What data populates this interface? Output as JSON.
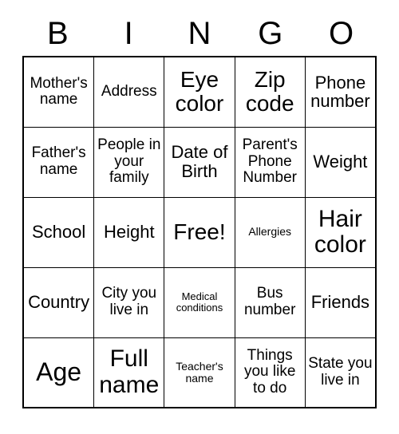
{
  "card": {
    "title_letters": [
      "B",
      "I",
      "N",
      "G",
      "O"
    ],
    "rows": [
      [
        {
          "text": "Mother's name",
          "size": "m"
        },
        {
          "text": "Address",
          "size": "m"
        },
        {
          "text": "Eye color",
          "size": "xl"
        },
        {
          "text": "Zip code",
          "size": "xl"
        },
        {
          "text": "Phone number",
          "size": "l"
        }
      ],
      [
        {
          "text": "Father's name",
          "size": "m"
        },
        {
          "text": "People in your family",
          "size": "m"
        },
        {
          "text": "Date of Birth",
          "size": "l"
        },
        {
          "text": "Parent's Phone Number",
          "size": "m"
        },
        {
          "text": "Weight",
          "size": "l"
        }
      ],
      [
        {
          "text": "School",
          "size": "l"
        },
        {
          "text": "Height",
          "size": "l"
        },
        {
          "text": "Free!",
          "size": "xl"
        },
        {
          "text": "Allergies",
          "size": "s"
        },
        {
          "text": "Hair color",
          "size": "xxl"
        }
      ],
      [
        {
          "text": "Country",
          "size": "l"
        },
        {
          "text": "City you live in",
          "size": "m"
        },
        {
          "text": "Medical conditions",
          "size": "xs"
        },
        {
          "text": "Bus number",
          "size": "m"
        },
        {
          "text": "Friends",
          "size": "l"
        }
      ],
      [
        {
          "text": "Age",
          "size": "huge"
        },
        {
          "text": "Full name",
          "size": "xxl"
        },
        {
          "text": "Teacher's name",
          "size": "s"
        },
        {
          "text": "Things you like to do",
          "size": "m"
        },
        {
          "text": "State you live in",
          "size": "m"
        }
      ]
    ]
  },
  "colors": {
    "ink": "#000000",
    "paper": "#ffffff"
  }
}
